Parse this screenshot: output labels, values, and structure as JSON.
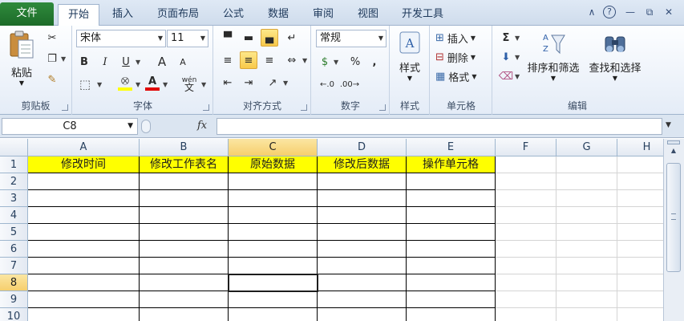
{
  "tabs": {
    "file": "文件",
    "home": "开始",
    "insert": "插入",
    "layout": "页面布局",
    "formulas": "公式",
    "data": "数据",
    "review": "审阅",
    "view": "视图",
    "developer": "开发工具"
  },
  "ribbon": {
    "clipboard": {
      "label": "剪贴板",
      "paste": "粘贴"
    },
    "font": {
      "label": "字体",
      "name": "宋体",
      "size": "11",
      "bold": "B",
      "italic": "I",
      "underline": "U",
      "grow": "A",
      "shrink": "A",
      "wen": "wén"
    },
    "alignment": {
      "label": "对齐方式"
    },
    "number": {
      "label": "数字",
      "format": "常规",
      "currency": "$",
      "percent": "%",
      "comma": ","
    },
    "styles": {
      "label": "样式",
      "button": "样式"
    },
    "cells": {
      "label": "单元格",
      "insert": "插入",
      "delete": "删除",
      "format": "格式"
    },
    "editing": {
      "label": "编辑",
      "sort_filter": "排序和筛选",
      "find_select": "查找和选择",
      "sum": "Σ"
    }
  },
  "formula_bar": {
    "name_box": "C8",
    "fx": "fx",
    "content": ""
  },
  "columns": [
    "A",
    "B",
    "C",
    "D",
    "E",
    "F",
    "G",
    "H"
  ],
  "rows": [
    "1",
    "2",
    "3",
    "4",
    "5",
    "6",
    "7",
    "8",
    "9",
    "10"
  ],
  "header_row": [
    "修改时间",
    "修改工作表名",
    "原始数据",
    "修改后数据",
    "操作单元格"
  ],
  "selected_cell": "C8",
  "colors": {
    "header_fill": "#ffff00",
    "selected_header": "#f8d374"
  }
}
